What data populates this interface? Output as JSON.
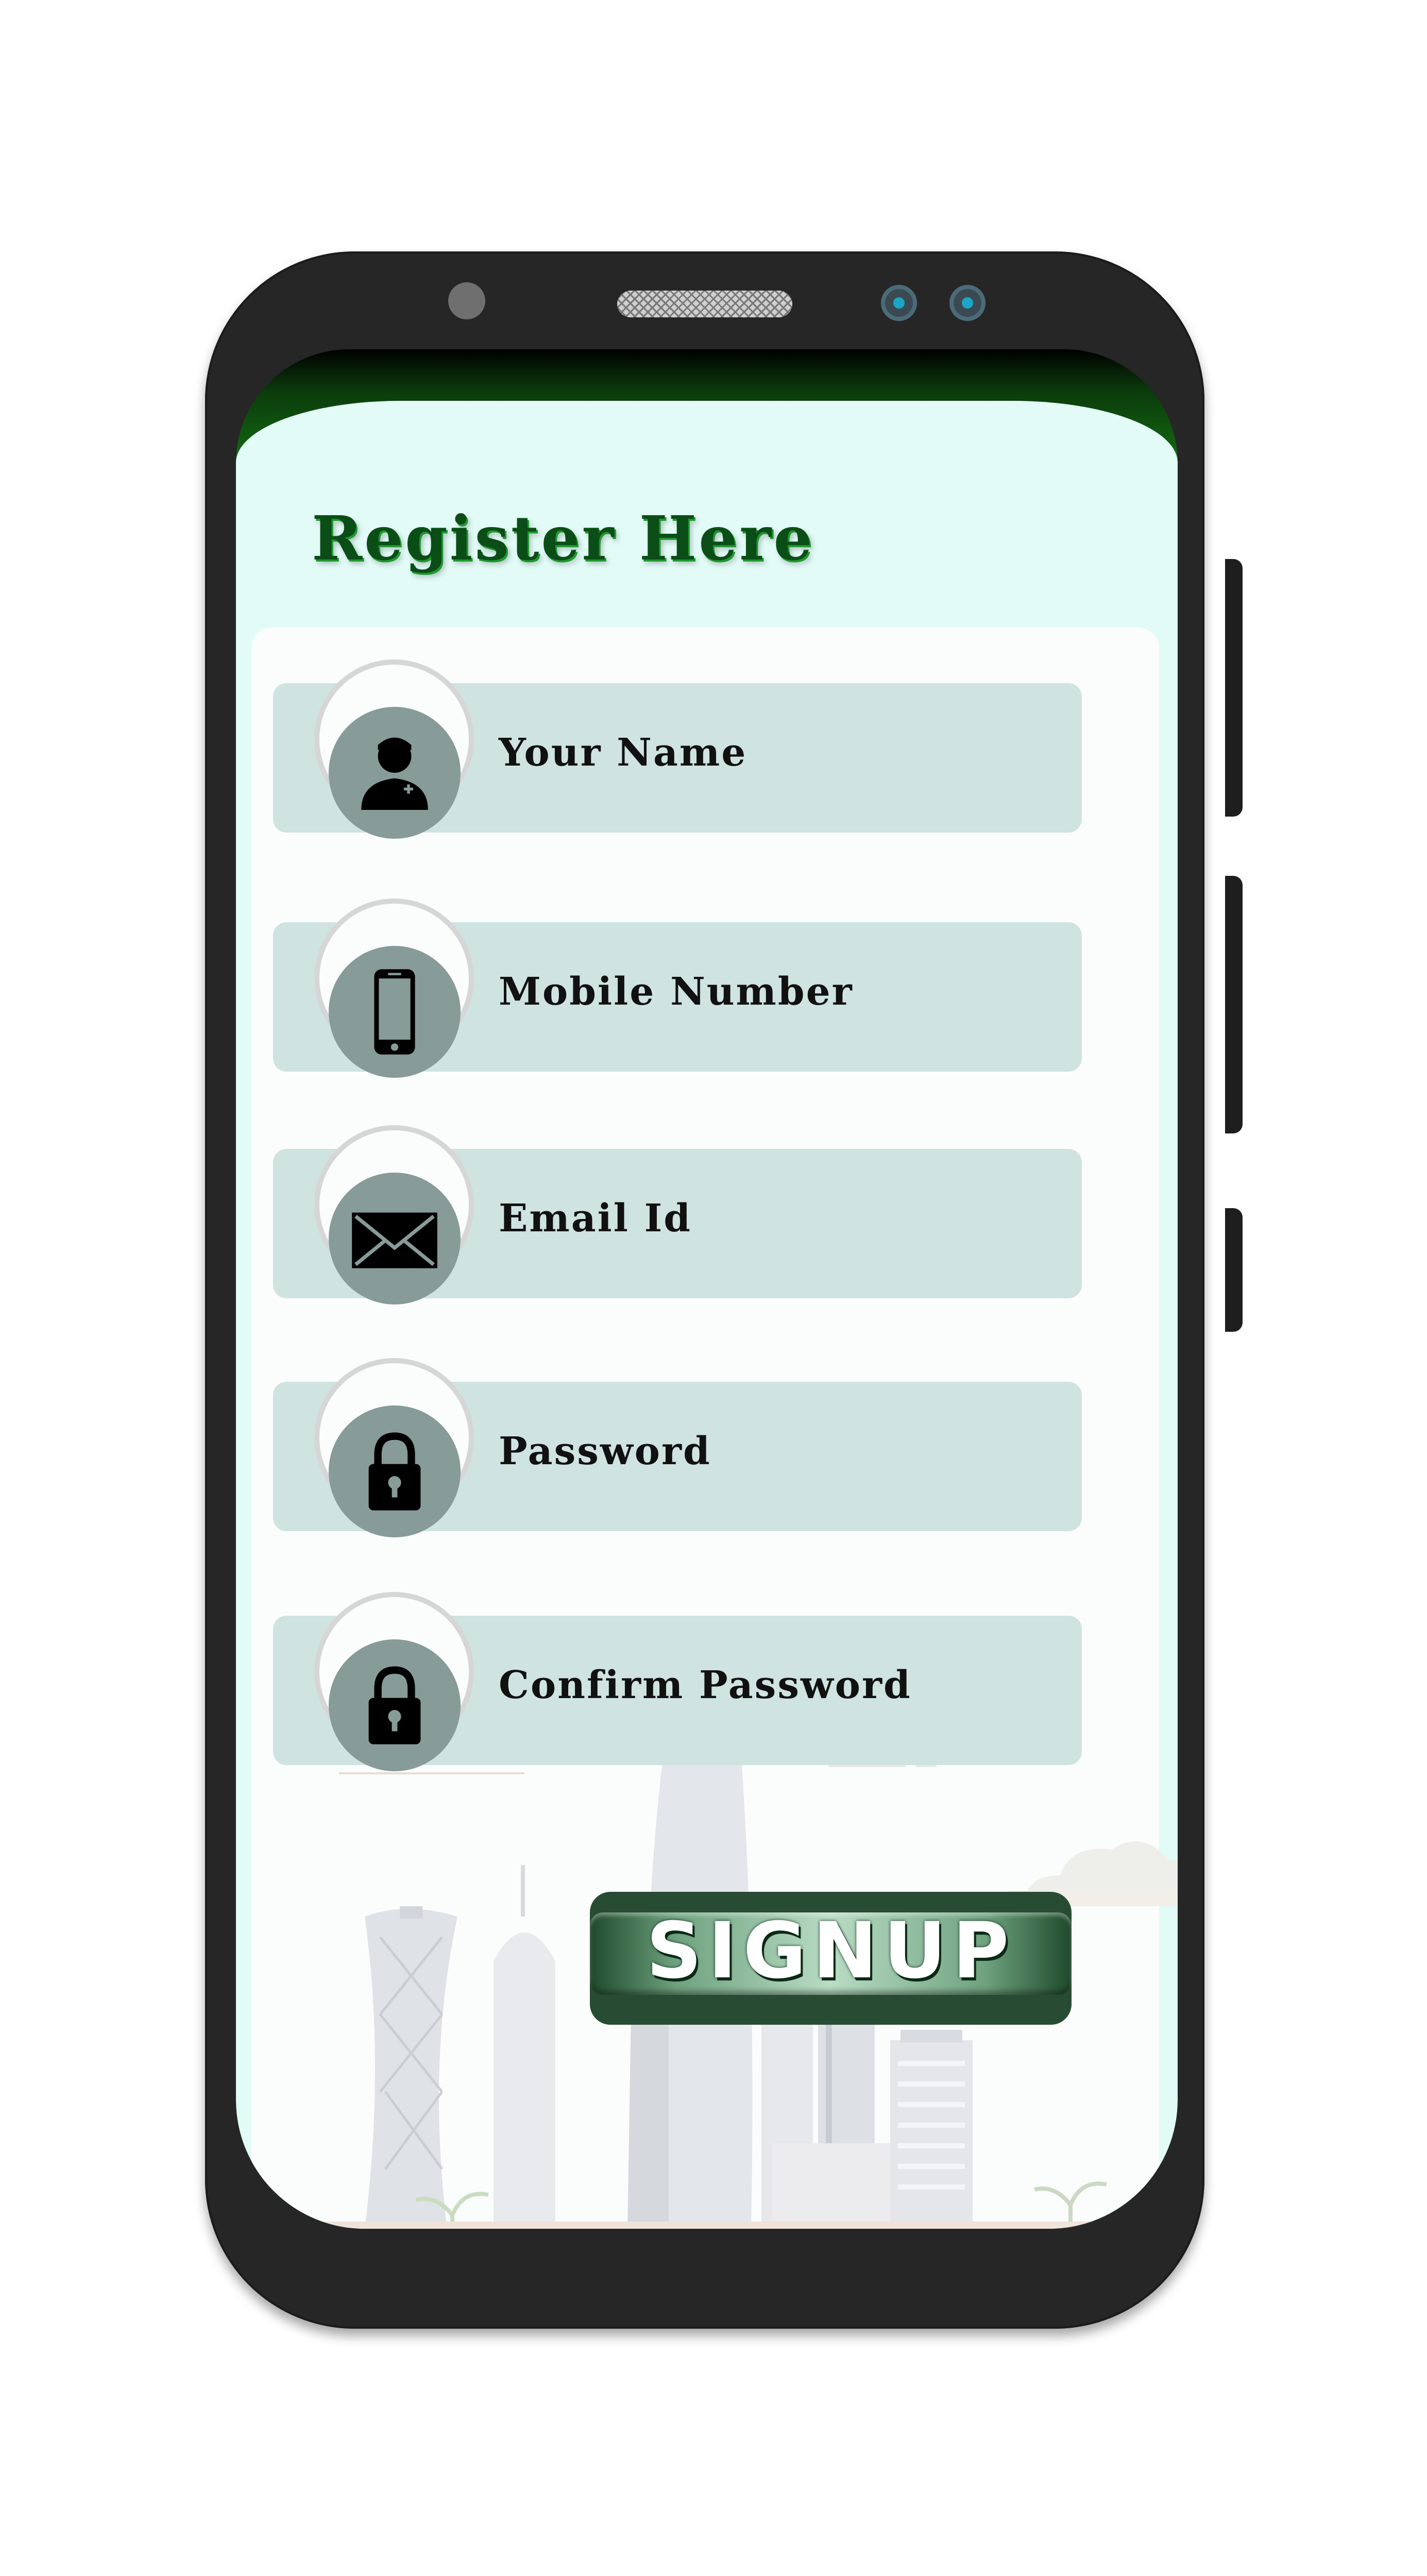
{
  "register": {
    "title": "Register Here"
  },
  "fields": [
    {
      "label": "Your Name",
      "icon": "user-icon"
    },
    {
      "label": "Mobile Number",
      "icon": "mobile-phone-icon"
    },
    {
      "label": "Email Id",
      "icon": "envelope-icon"
    },
    {
      "label": "Password",
      "icon": "lock-icon"
    },
    {
      "label": "Confirm Password",
      "icon": "lock-icon"
    }
  ],
  "signup": {
    "label": "SIGNUP"
  },
  "colors": {
    "header_green": "#167a16",
    "title_green": "#0b4d17",
    "field_bg": "#cfe3e0",
    "icon_circle": "#879b99",
    "screen_bg": "#e2fbf7",
    "button_green": "#284b34"
  }
}
